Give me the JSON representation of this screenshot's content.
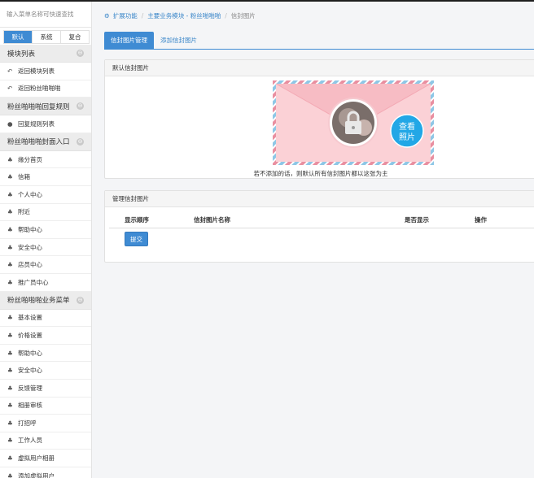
{
  "sidebar": {
    "search_placeholder": "输入菜单名称可快速查找",
    "tabs": [
      "默认",
      "系统",
      "复合"
    ],
    "sections": [
      {
        "title": "模块列表",
        "items": [
          "返回模块列表",
          "返回粉丝啪啪啪"
        ]
      },
      {
        "title": "粉丝啪啪啪回复规则",
        "items": [
          "回复规则列表"
        ]
      },
      {
        "title": "粉丝啪啪啪封面入口",
        "items": [
          "缘分首页",
          "信箱",
          "个人中心",
          "附近",
          "帮助中心",
          "安全中心",
          "店员中心",
          "推广员中心"
        ]
      },
      {
        "title": "粉丝啪啪啪业务菜单",
        "items": [
          "基本设置",
          "价格设置",
          "帮助中心",
          "安全中心",
          "反馈管理",
          "相册审核",
          "打招呼",
          "工作人员",
          "虚拟用户相册",
          "添加虚拟用户"
        ]
      }
    ]
  },
  "breadcrumb": {
    "items": [
      "扩展功能",
      "主要业务模块 - 粉丝啪啪啪",
      "信封图片"
    ]
  },
  "page_tabs": [
    "信封图片管理",
    "添加信封图片"
  ],
  "default_panel": {
    "title": "默认信封图片",
    "badge_line1": "查看",
    "badge_line2": "照片",
    "caption": "若不添加的话，则默认所有信封图片都以这张为主"
  },
  "manage_panel": {
    "title": "管理信封图片",
    "columns": [
      "显示顺序",
      "信封图片名称",
      "是否显示",
      "操作"
    ],
    "submit_label": "提交"
  },
  "colors": {
    "accent": "#3f8bd3",
    "envelope_pink": "#f8c7cc",
    "badge_blue": "#22a7e6"
  }
}
